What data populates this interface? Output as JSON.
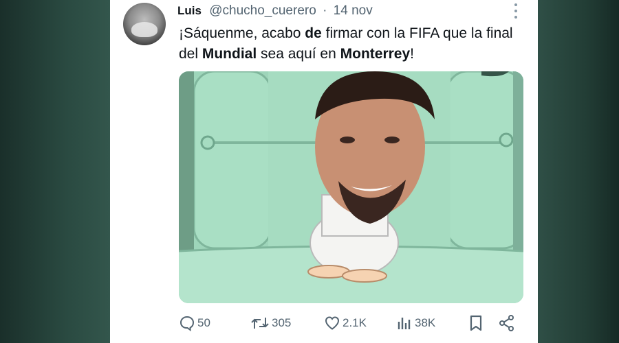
{
  "tweet": {
    "author_name": "Luis",
    "handle": "@chucho_cuerero",
    "separator": "·",
    "date": "14 nov",
    "text_parts": [
      "¡Sáquenme, acabo ",
      "de",
      " firmar con la FIFA que la final del ",
      "Mundial",
      " sea aquí en ",
      "Monterrey",
      "!"
    ]
  },
  "media": {
    "description_icon": "meme-image"
  },
  "actions": {
    "replies": "50",
    "reposts": "305",
    "likes": "2.1K",
    "views": "38K"
  },
  "colors": {
    "text": "#0f1419",
    "secondary": "#536471",
    "media_bg": "#9fd6bb"
  }
}
